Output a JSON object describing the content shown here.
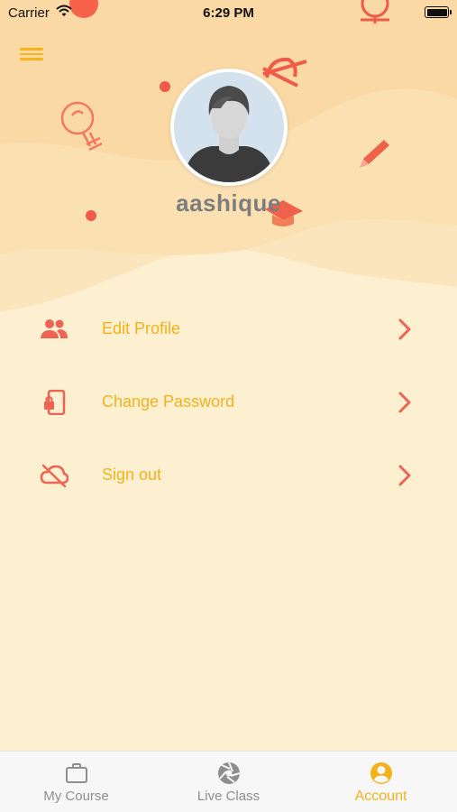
{
  "status_bar": {
    "carrier": "Carrier",
    "time": "6:29 PM"
  },
  "header": {
    "menu_icon": "hamburger-icon"
  },
  "profile": {
    "username": "aashique",
    "avatar_icon": "default-user-avatar"
  },
  "menu": {
    "items": [
      {
        "label": "Edit Profile",
        "icon": "people-icon"
      },
      {
        "label": "Change Password",
        "icon": "phone-lock-icon"
      },
      {
        "label": "Sign out",
        "icon": "cloud-off-icon"
      }
    ]
  },
  "tabs": [
    {
      "label": "My Course",
      "icon": "briefcase-icon",
      "active": false
    },
    {
      "label": "Live Class",
      "icon": "aperture-icon",
      "active": false
    },
    {
      "label": "Account",
      "icon": "user-circle-icon",
      "active": true
    }
  ],
  "colors": {
    "accent": "#f5b11a",
    "icon_red": "#ee6353",
    "background": "#fdf0d1",
    "header_wave": "#fbdcaa",
    "tab_inactive": "#8e8e8e"
  }
}
